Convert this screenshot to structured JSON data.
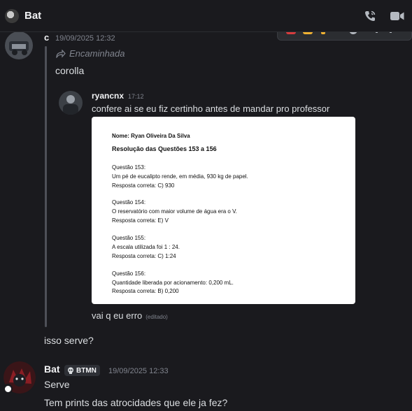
{
  "header": {
    "title": "Bat",
    "call_icon": "phone-call-icon",
    "video_icon": "video-camera-icon"
  },
  "messages": {
    "first": {
      "author": "c",
      "timestamp": "19/09/2025 12:32",
      "forward_label": "Encaminhada",
      "text": "corolla",
      "nested": {
        "author": "ryancnx",
        "timestamp": "17:12",
        "text": "confere ai se eu fiz certinho antes de mandar pro professor",
        "attachment": {
          "lines": [
            "Nome: Ryan Oliveira Da Silva",
            "Resolução das Questões 153 a 156",
            "Questão 153:",
            "Um pé de eucalipto rende, em média, 930 kg de papel.",
            "Resposta correta: C) 930",
            "Questão 154:",
            "O reservatório com maior volume de água era o V.",
            "Resposta correta: E) V",
            "Questão 155:",
            "A escala utilizada foi 1 : 24.",
            "Resposta correta: C) 1:24",
            "Questão 156:",
            "Quantidade liberada por acionamento: 0,200 mL.",
            "Resposta correta: B) 0,200"
          ]
        },
        "followup_text": "vai q eu erro",
        "edited_label": "(editado)"
      },
      "reply_text": "isso serve?"
    },
    "second": {
      "author": "Bat",
      "badge": "BTMN",
      "timestamp": "19/09/2025 12:33",
      "lines": [
        "Serve",
        "Tem prints das atrocidades que ele ja fez?"
      ]
    }
  },
  "colors": {
    "background": "#1a1a1e",
    "text": "#dbdee1",
    "muted": "#80848e",
    "divider": "#4e5058"
  }
}
